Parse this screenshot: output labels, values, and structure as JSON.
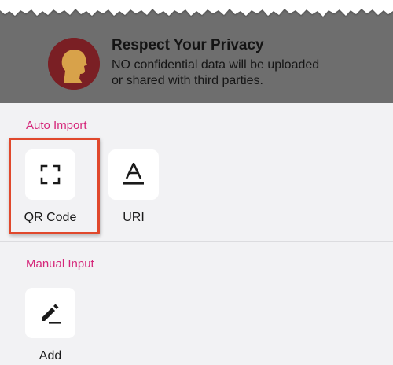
{
  "privacy": {
    "title": "Respect Your Privacy",
    "line1": "NO confidential data will be uploaded",
    "line2": "or shared with third parties."
  },
  "auto_import": {
    "label": "Auto Import",
    "items": [
      {
        "label": "QR Code",
        "icon": "qr-scan-icon"
      },
      {
        "label": "URI",
        "icon": "text-a-icon"
      }
    ]
  },
  "manual_input": {
    "label": "Manual Input",
    "items": [
      {
        "label": "Add",
        "icon": "pencil-icon"
      }
    ]
  },
  "colors": {
    "banner": "#6e6e6e",
    "section_label": "#d5277a",
    "highlight": "#e0482c",
    "avatar_bg": "#7a1f24"
  }
}
